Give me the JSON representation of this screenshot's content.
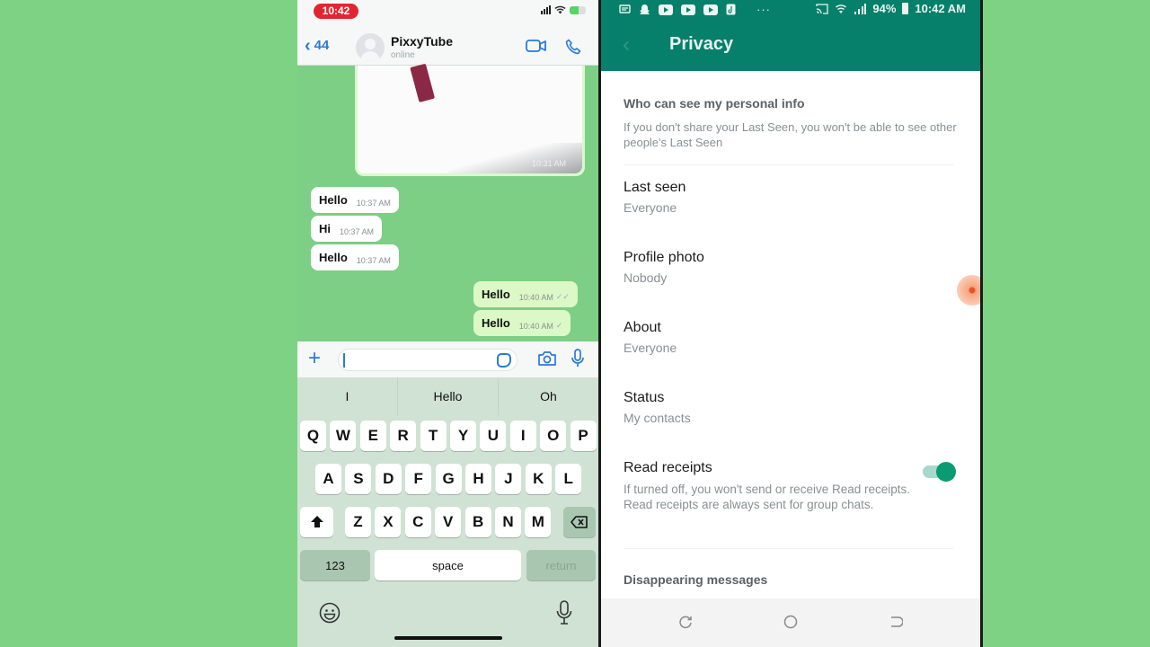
{
  "iphone": {
    "status_time": "10:42",
    "header": {
      "back_count": "44",
      "contact_name": "PixxyTube",
      "contact_status": "online"
    },
    "image_message_time": "10:31 AM",
    "messages": [
      {
        "direction": "in",
        "text": "Hello",
        "time": "10:37 AM"
      },
      {
        "direction": "in",
        "text": "Hi",
        "time": "10:37 AM"
      },
      {
        "direction": "in",
        "text": "Hello",
        "time": "10:37 AM"
      },
      {
        "direction": "out",
        "text": "Hello",
        "time": "10:40 AM",
        "tick": "✓✓"
      },
      {
        "direction": "out",
        "text": "Hello",
        "time": "10:40 AM",
        "tick": "✓"
      }
    ],
    "input": {
      "value": "",
      "placeholder": ""
    },
    "suggestions": [
      "I",
      "Hello",
      "Oh"
    ],
    "keyboard": {
      "row1": [
        "Q",
        "W",
        "E",
        "R",
        "T",
        "Y",
        "U",
        "I",
        "O",
        "P"
      ],
      "row2": [
        "A",
        "S",
        "D",
        "F",
        "G",
        "H",
        "J",
        "K",
        "L"
      ],
      "row3": [
        "Z",
        "X",
        "C",
        "V",
        "B",
        "N",
        "M"
      ],
      "numbers_label": "123",
      "space_label": "space",
      "return_label": "return"
    }
  },
  "android": {
    "status": {
      "battery": "94%",
      "time": "10:42 AM"
    },
    "title": "Privacy",
    "section_header": "Who can see my personal info",
    "section_desc": "If you don't share your Last Seen, you won't be able to see other people's Last Seen",
    "items": [
      {
        "title": "Last seen",
        "value": "Everyone"
      },
      {
        "title": "Profile photo",
        "value": "Nobody"
      },
      {
        "title": "About",
        "value": "Everyone"
      },
      {
        "title": "Status",
        "value": "My contacts"
      }
    ],
    "read_receipts": {
      "title": "Read receipts",
      "desc": "If turned off, you won't send or receive Read receipts. Read receipts are always sent for group chats.",
      "enabled": true
    },
    "disappearing_header": "Disappearing messages"
  },
  "colors": {
    "background": "#7dd283",
    "whatsapp_teal": "#07806b",
    "toggle_on": "#0b9b72",
    "ios_blue": "#2a7bd4",
    "time_badge": "#e2262d"
  }
}
